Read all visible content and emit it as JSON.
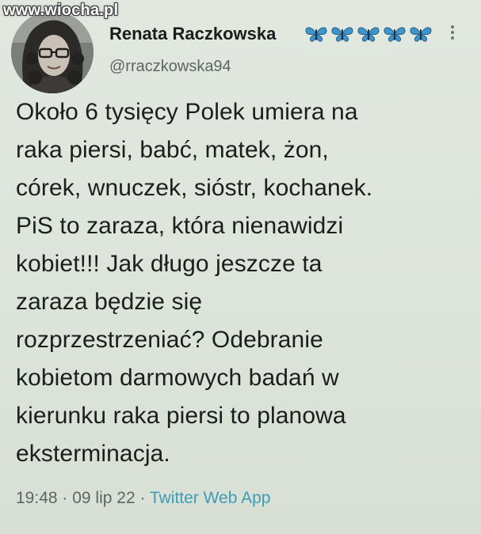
{
  "watermark": "www.wiocha.pl",
  "profile": {
    "display_name": "Renata Raczkowska",
    "handle": "@rraczkowska94",
    "badge_icons": [
      "butterfly-emoji",
      "butterfly-emoji",
      "butterfly-emoji",
      "butterfly-emoji",
      "butterfly-emoji"
    ],
    "badge_color": "#3f95c9"
  },
  "tweet": {
    "lines": [
      "Około 6 tysięcy Polek umiera na",
      "raka piersi, babć, matek, żon,",
      "córek, wnuczek, sióstr, kochanek.",
      "PiS to zaraza, która nienawidzi",
      "kobiet!!! Jak długo jeszcze ta",
      "zaraza będzie się",
      "rozprzestrzeniać? Odebranie",
      "kobietom darmowych badań w",
      "kierunku raka piersi to planowa",
      "eksterminacja."
    ]
  },
  "meta": {
    "time": "19:48",
    "sep1": " · ",
    "date": "09 lip 22",
    "sep2": " · ",
    "app": "Twitter Web App",
    "link_color": "#3f9bb6"
  }
}
